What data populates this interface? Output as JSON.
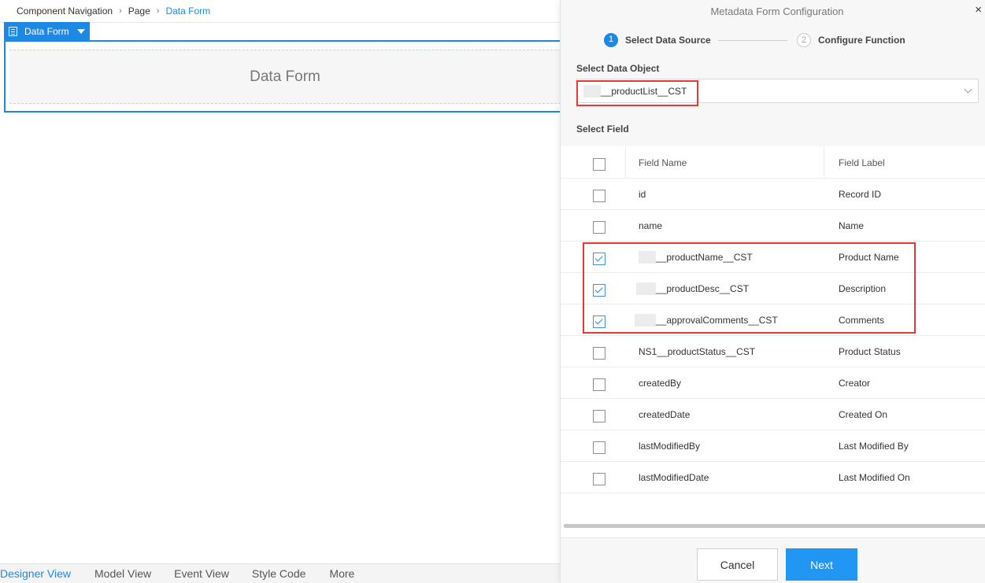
{
  "breadcrumb": {
    "items": [
      "Component Navigation",
      "Page"
    ],
    "current": "Data Form",
    "separator": ">"
  },
  "component": {
    "tag_label": "Data Form",
    "placeholder": "Data Form",
    "accent": "#1e88e5"
  },
  "bottom_tabs": [
    "Designer View",
    "Model View",
    "Event View",
    "Style Code",
    "More"
  ],
  "panel": {
    "title": "Metadata Form Configuration",
    "close": "×",
    "steps": [
      {
        "number": "1",
        "label": "Select Data Source",
        "active": true
      },
      {
        "number": "2",
        "label": "Configure Function",
        "active": false
      }
    ],
    "data_object": {
      "label": "Select Data Object",
      "value": "__productList__CST",
      "visible_value": "__productList__CST"
    },
    "field_section_label": "Select Field",
    "columns": {
      "name": "Field Name",
      "label": "Field Label"
    },
    "fields": [
      {
        "name": "id",
        "label": "Record ID",
        "checked": false,
        "masked": false
      },
      {
        "name": "name",
        "label": "Name",
        "checked": false,
        "masked": false
      },
      {
        "name": "__productName__CST",
        "label": "Product Name",
        "checked": true,
        "masked": true
      },
      {
        "name": "__productDesc__CST",
        "label": "Description",
        "checked": true,
        "masked": true
      },
      {
        "name": "__approvalComments__CST",
        "label": "Comments",
        "checked": true,
        "masked": true
      },
      {
        "name": "NS1__productStatus__CST",
        "label": "Product Status",
        "checked": false,
        "masked": false
      },
      {
        "name": "createdBy",
        "label": "Creator",
        "checked": false,
        "masked": false
      },
      {
        "name": "createdDate",
        "label": "Created On",
        "checked": false,
        "masked": false
      },
      {
        "name": "lastModifiedBy",
        "label": "Last Modified By",
        "checked": false,
        "masked": false
      },
      {
        "name": "lastModifiedDate",
        "label": "Last Modified On",
        "checked": false,
        "masked": false
      }
    ],
    "buttons": {
      "cancel": "Cancel",
      "next": "Next"
    },
    "colors": {
      "primary": "#2196f3",
      "highlight": "#e53935"
    }
  }
}
